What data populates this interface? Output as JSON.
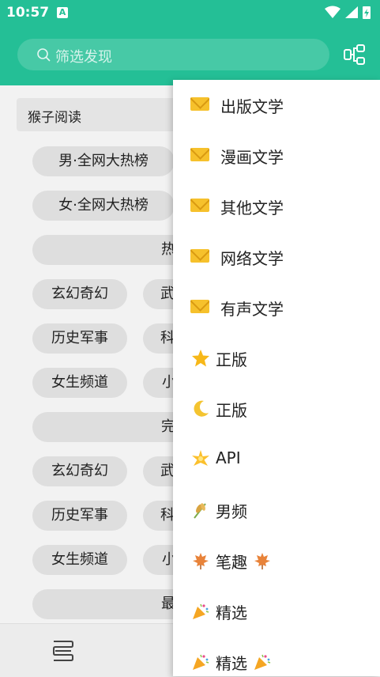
{
  "status_bar": {
    "time": "10:57",
    "notification_letter": "A"
  },
  "search": {
    "placeholder": "筛选发现"
  },
  "source": {
    "title": "猴子阅读"
  },
  "chips": [
    {
      "label": "男·全网大热榜"
    },
    {
      "label": "女·全网大热榜"
    },
    {
      "label": "热"
    },
    {
      "label": "玄幻奇幻"
    },
    {
      "label": "武"
    },
    {
      "label": "历史军事"
    },
    {
      "label": "科"
    },
    {
      "label": "女生频道"
    },
    {
      "label": "小"
    },
    {
      "label": "完"
    },
    {
      "label": "玄幻奇幻"
    },
    {
      "label": "武"
    },
    {
      "label": "历史军事"
    },
    {
      "label": "科"
    },
    {
      "label": "女生频道"
    },
    {
      "label": "小"
    },
    {
      "label": "最"
    }
  ],
  "menu": {
    "items": [
      {
        "label": "出版文学",
        "icon": "envelope-icon"
      },
      {
        "label": "漫画文学",
        "icon": "envelope-icon"
      },
      {
        "label": "其他文学",
        "icon": "envelope-icon"
      },
      {
        "label": "网络文学",
        "icon": "envelope-icon"
      },
      {
        "label": "有声文学",
        "icon": "envelope-icon"
      },
      {
        "label": "正版",
        "icon": "star-icon"
      },
      {
        "label": "正版",
        "icon": "moon-icon"
      },
      {
        "label": "API",
        "icon": "glowing-star-icon"
      },
      {
        "label": "男频",
        "icon": "wheat-icon"
      },
      {
        "label": "笔趣",
        "icon": "maple-leaf-icon"
      },
      {
        "label": "精选",
        "icon": "party-popper-icon"
      },
      {
        "label": "精选",
        "icon": "party-popper-icon"
      }
    ]
  },
  "colors": {
    "accent": "#24bf96",
    "chip_bg": "#dedede",
    "menu_bg": "#ffffff"
  }
}
